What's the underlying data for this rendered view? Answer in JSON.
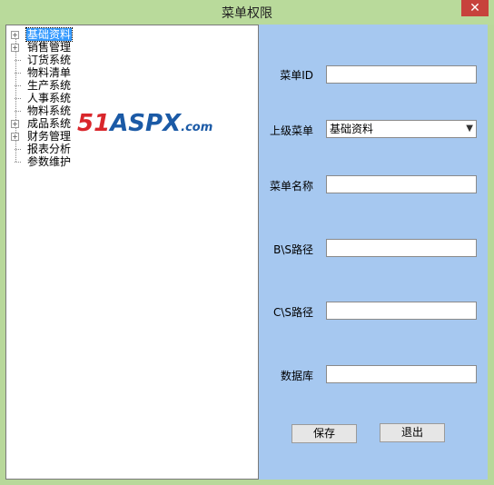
{
  "window": {
    "title": "菜单权限",
    "close_label": "✕"
  },
  "tree": {
    "nodes": [
      {
        "label": "基础资料",
        "expandable": true,
        "selected": true
      },
      {
        "label": "销售管理",
        "expandable": true,
        "selected": false
      },
      {
        "label": "订货系统",
        "expandable": false,
        "selected": false
      },
      {
        "label": "物料清单",
        "expandable": false,
        "selected": false
      },
      {
        "label": "生产系统",
        "expandable": false,
        "selected": false
      },
      {
        "label": "人事系统",
        "expandable": false,
        "selected": false
      },
      {
        "label": "物料系统",
        "expandable": false,
        "selected": false
      },
      {
        "label": "成品系统",
        "expandable": true,
        "selected": false
      },
      {
        "label": "财务管理",
        "expandable": true,
        "selected": false
      },
      {
        "label": "报表分析",
        "expandable": false,
        "selected": false
      },
      {
        "label": "参数维护",
        "expandable": false,
        "selected": false
      }
    ],
    "expander_symbol": "+"
  },
  "watermark": {
    "number": "51",
    "brand": "ASPX",
    "suffix": ".com"
  },
  "form": {
    "menu_id_label": "菜单ID",
    "menu_id_value": "",
    "parent_menu_label": "上级菜单",
    "parent_menu_value": "基础资料",
    "menu_name_label": "菜单名称",
    "menu_name_value": "",
    "bs_path_label": "B\\S路径",
    "bs_path_value": "",
    "cs_path_label": "C\\S路径",
    "cs_path_value": "",
    "database_label": "数据库",
    "database_value": ""
  },
  "buttons": {
    "save": "保存",
    "exit": "退出"
  }
}
